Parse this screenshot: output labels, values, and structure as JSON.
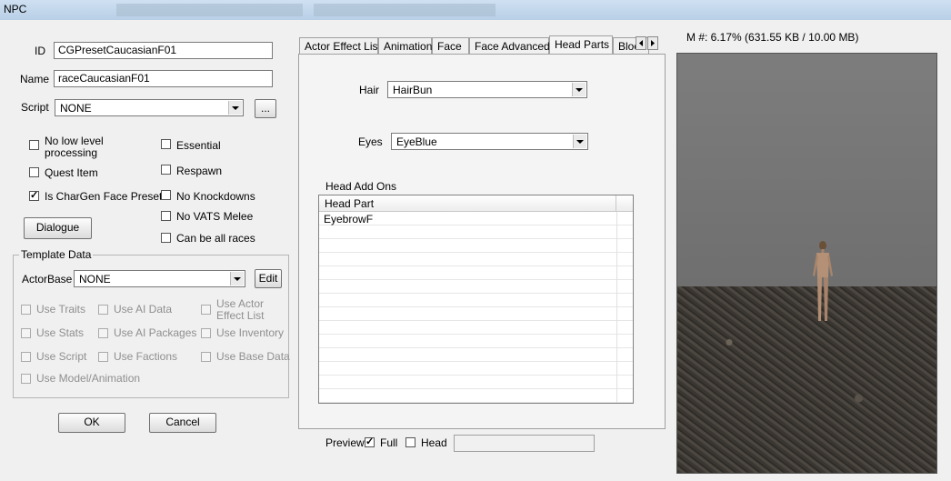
{
  "window": {
    "title": "NPC"
  },
  "form": {
    "id_label": "ID",
    "id_value": "CGPresetCaucasianF01",
    "name_label": "Name",
    "name_value": "raceCaucasianF01",
    "script_label": "Script",
    "script_value": "NONE",
    "script_browse": "...",
    "flags": {
      "no_low_level": {
        "label_line1": "No low level",
        "label_line2": "processing",
        "checked": false
      },
      "quest_item": {
        "label": "Quest Item",
        "checked": false
      },
      "is_chargen": {
        "label": "Is CharGen Face Preset",
        "checked": true
      },
      "essential": {
        "label": "Essential",
        "checked": false
      },
      "respawn": {
        "label": "Respawn",
        "checked": false
      },
      "no_knockdowns": {
        "label": "No Knockdowns",
        "checked": false
      },
      "no_vats_melee": {
        "label": "No VATS Melee",
        "checked": false
      },
      "can_be_all_races": {
        "label": "Can be all races",
        "checked": false
      }
    },
    "dialogue_button": "Dialogue",
    "ok_button": "OK",
    "cancel_button": "Cancel"
  },
  "template": {
    "title": "Template Data",
    "actorbase_label": "ActorBase",
    "actorbase_value": "NONE",
    "edit_button": "Edit",
    "use_traits": "Use Traits",
    "use_ai_data": "Use AI Data",
    "use_actor_effect_line1": "Use Actor",
    "use_actor_effect_line2": "Effect List",
    "use_stats": "Use Stats",
    "use_ai_packages": "Use AI Packages",
    "use_inventory": "Use Inventory",
    "use_script": "Use Script",
    "use_factions": "Use Factions",
    "use_base_data": "Use Base Data",
    "use_model_animation": "Use Model/Animation"
  },
  "tabs": {
    "actor_effect_list": "Actor Effect List",
    "animation": "Animation",
    "face": "Face",
    "face_advanced": "Face Advanced",
    "head_parts": "Head Parts",
    "blood": "Bloo",
    "active": "Head Parts"
  },
  "head_parts": {
    "hair_label": "Hair",
    "hair_value": "HairBun",
    "eyes_label": "Eyes",
    "eyes_value": "EyeBlue",
    "addons_label": "Head Add Ons",
    "column_header": "Head Part",
    "rows": [
      "EyebrowF"
    ]
  },
  "bottom": {
    "preview_label": "Preview",
    "full_label": "Full",
    "full_checked": true,
    "head_label": "Head",
    "head_checked": false
  },
  "memory": {
    "text": "M #: 6.17% (631.55 KB / 10.00 MB)"
  }
}
